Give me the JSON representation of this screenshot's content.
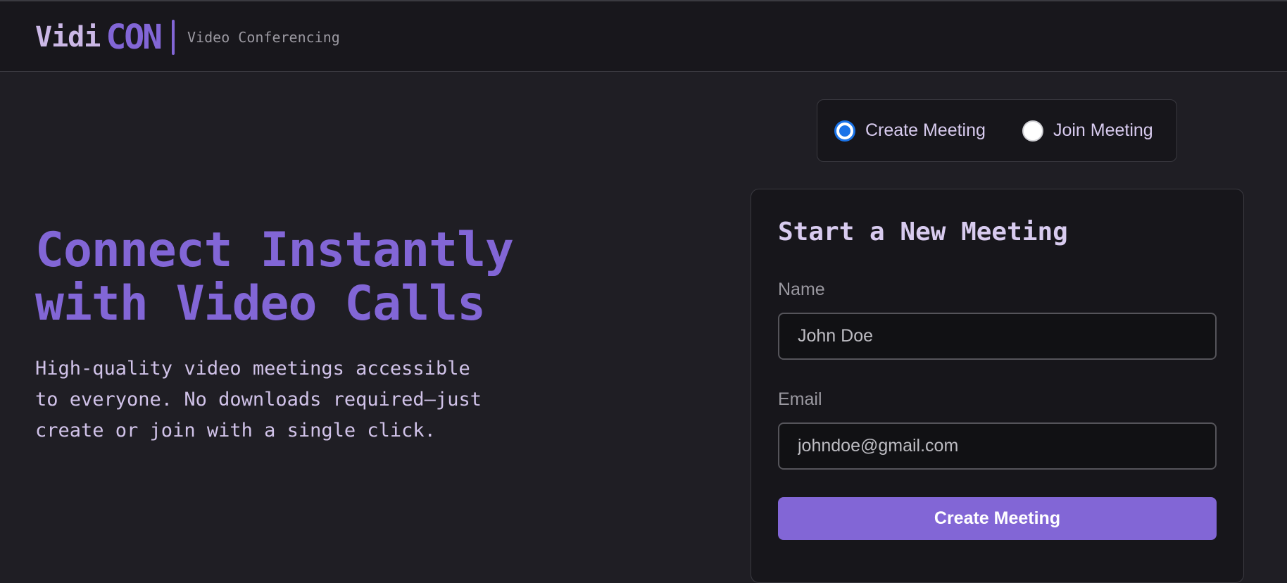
{
  "header": {
    "logo_part1": "Vidi",
    "logo_part2": "CON",
    "tagline": "Video Conferencing"
  },
  "hero": {
    "title_line1": "Connect Instantly",
    "title_line2": "with Video Calls",
    "subtitle_line1": "High-quality video meetings accessible",
    "subtitle_line2": "to everyone. No downloads required—just",
    "subtitle_line3": "create or join with a single click."
  },
  "mode_toggle": {
    "options": [
      {
        "label": "Create Meeting",
        "selected": true
      },
      {
        "label": "Join Meeting",
        "selected": false
      }
    ]
  },
  "form": {
    "title": "Start a New Meeting",
    "name_label": "Name",
    "name_placeholder": "John Doe",
    "email_label": "Email",
    "email_placeholder": "johndoe@gmail.com",
    "submit_label": "Create Meeting"
  },
  "colors": {
    "background": "#1f1e24",
    "accent": "#8266d6",
    "radio_selected": "#1a73e8"
  }
}
